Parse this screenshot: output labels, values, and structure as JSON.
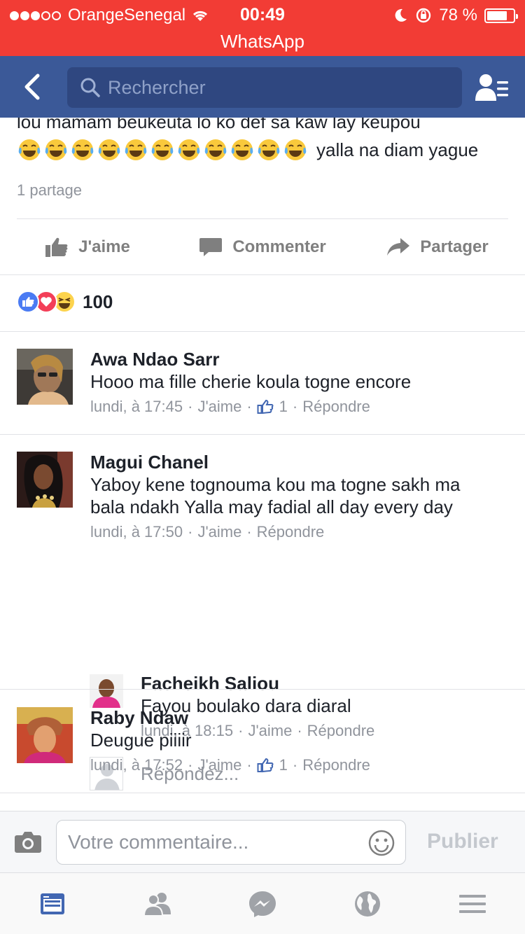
{
  "status_bar": {
    "carrier": "OrangeSenegal",
    "time": "00:49",
    "battery_percent": "78 %",
    "battery_level": 0.78,
    "back_to_app": "WhatsApp"
  },
  "nav": {
    "search_placeholder": "Rechercher"
  },
  "post": {
    "text_line1": "lou mamam beukeuta lo ko def sa kaw lay keupou",
    "emoji_count": 11,
    "text_line2": "yalla na diam yague",
    "shares": "1 partage",
    "actions": {
      "like": "J'aime",
      "comment": "Commenter",
      "share": "Partager"
    },
    "reaction_count": "100"
  },
  "comments": [
    {
      "name": "Awa Ndao Sarr",
      "text": "Hooo ma fille cherie koula togne encore",
      "time": "lundi, à 17:45",
      "like": "J'aime",
      "likes": "1",
      "reply": "Répondre"
    },
    {
      "name": "Magui Chanel",
      "text_line1": "Yaboy kene tognouma kou ma togne sakh ma",
      "text_line2": "bala ndakh Yalla may fadial all day every day",
      "time": "lundi, à 17:50",
      "like": "J'aime",
      "reply": "Répondre",
      "replies": [
        {
          "name": "Facheikh Saliou",
          "text": "Fayou boulako dara diaral",
          "time": "lundi, à 18:15",
          "like": "J'aime",
          "reply": "Répondre"
        }
      ],
      "reply_placeholder": "Répondez..."
    },
    {
      "name": "Raby Ndaw",
      "text": "Deugue piiiir",
      "time": "lundi, à 17:52",
      "like": "J'aime",
      "likes": "1",
      "reply": "Répondre"
    }
  ],
  "composer": {
    "placeholder": "Votre commentaire...",
    "publish": "Publier"
  },
  "colors": {
    "status_bar": "#f23c35",
    "nav": "#3b5998",
    "link_blue": "#4267b2"
  }
}
